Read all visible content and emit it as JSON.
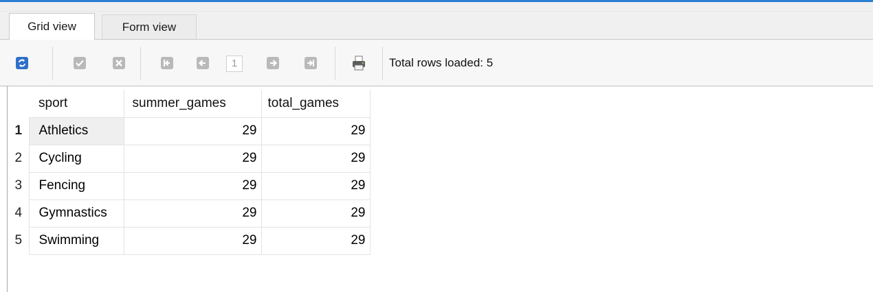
{
  "tabs": [
    {
      "label": "Grid view",
      "active": true
    },
    {
      "label": "Form view",
      "active": false
    }
  ],
  "toolbar": {
    "buttons": [
      "refresh-icon",
      "commit-icon",
      "rollback-icon",
      "first-page-icon",
      "previous-page-icon",
      "next-page-icon",
      "last-page-icon",
      "print-icon"
    ],
    "page_number": "1",
    "status_text": "Total rows loaded: 5"
  },
  "grid": {
    "columns": [
      "sport",
      "summer_games",
      "total_games"
    ],
    "rows": [
      {
        "num": "1",
        "sport": "Athletics",
        "summer_games": "29",
        "total_games": "29"
      },
      {
        "num": "2",
        "sport": "Cycling",
        "summer_games": "29",
        "total_games": "29"
      },
      {
        "num": "3",
        "sport": "Fencing",
        "summer_games": "29",
        "total_games": "29"
      },
      {
        "num": "4",
        "sport": "Gymnastics",
        "summer_games": "29",
        "total_games": "29"
      },
      {
        "num": "5",
        "sport": "Swimming",
        "summer_games": "29",
        "total_games": "29"
      }
    ]
  },
  "colors": {
    "accent": "#2a7fd4",
    "refresh": "#2f6fc9"
  }
}
